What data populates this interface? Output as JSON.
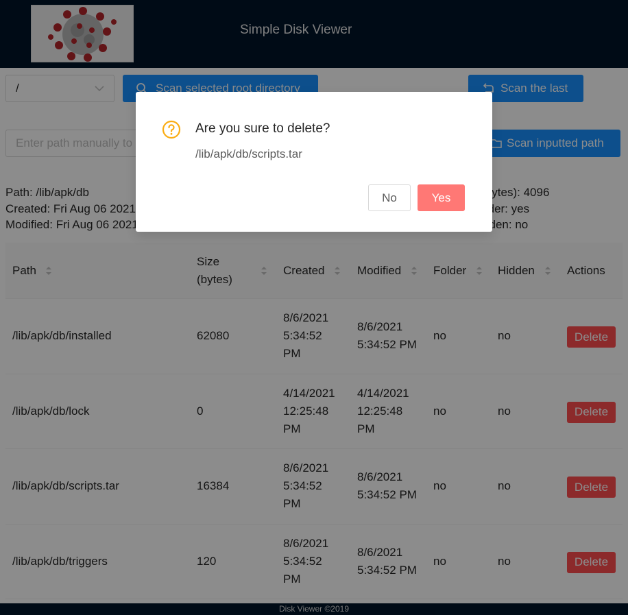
{
  "header": {
    "title": "Simple Disk Viewer"
  },
  "toolbar": {
    "root_select_value": "/",
    "scan_root_label": "Scan selected root directory",
    "scan_last_label": "Scan the last",
    "path_placeholder": "Enter path manually to",
    "scan_input_label": "Scan inputted path"
  },
  "info": {
    "left": {
      "path": "Path: /lib/apk/db",
      "created": "Created: Fri Aug 06 2021",
      "modified": "Modified: Fri Aug 06 2021"
    },
    "right": {
      "size": "e (bytes): 4096",
      "folder": "Folder: yes",
      "hidden": "Hidden: no"
    }
  },
  "table": {
    "columns": {
      "path": "Path",
      "size_line1": "Size",
      "size_line2": "(bytes)",
      "created": "Created",
      "modified": "Modified",
      "folder": "Folder",
      "hidden": "Hidden",
      "actions": "Actions"
    },
    "rows": [
      {
        "path": "/lib/apk/db/installed",
        "size": "62080",
        "created": [
          "8/6/2021",
          "5:34:52",
          "PM"
        ],
        "modified": [
          "8/6/2021",
          "5:34:52 PM"
        ],
        "folder": "no",
        "hidden": "no",
        "action": "Delete"
      },
      {
        "path": "/lib/apk/db/lock",
        "size": "0",
        "created": [
          "4/14/2021",
          "12:25:48",
          "PM"
        ],
        "modified": [
          "4/14/2021",
          "12:25:48",
          "PM"
        ],
        "folder": "no",
        "hidden": "no",
        "action": "Delete"
      },
      {
        "path": "/lib/apk/db/scripts.tar",
        "size": "16384",
        "created": [
          "8/6/2021",
          "5:34:52",
          "PM"
        ],
        "modified": [
          "8/6/2021",
          "5:34:52 PM"
        ],
        "folder": "no",
        "hidden": "no",
        "action": "Delete"
      },
      {
        "path": "/lib/apk/db/triggers",
        "size": "120",
        "created": [
          "8/6/2021",
          "5:34:52",
          "PM"
        ],
        "modified": [
          "8/6/2021",
          "5:34:52 PM"
        ],
        "folder": "no",
        "hidden": "no",
        "action": "Delete"
      }
    ]
  },
  "footer": {
    "text": "Disk Viewer ©2019"
  },
  "modal": {
    "title": "Are you sure to delete?",
    "content": "/lib/apk/db/scripts.tar",
    "no_label": "No",
    "yes_label": "Yes"
  },
  "icons": {
    "search": "search-icon",
    "rollback": "rollback-icon",
    "folder": "folder-icon",
    "chevron": "chevron-down-icon",
    "sort": "sort-icon",
    "question": "question-circle-icon",
    "logo": "virus-logo"
  },
  "colors": {
    "header_bg": "#001529",
    "primary": "#1890ff",
    "danger": "#ff4d4f",
    "danger_light": "#ff7875",
    "warning": "#faad14"
  }
}
